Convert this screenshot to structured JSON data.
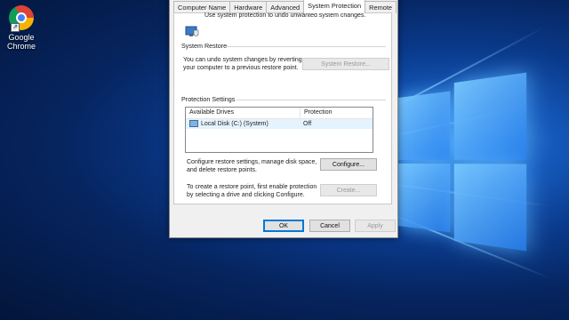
{
  "desktop": {
    "icons": [
      {
        "label_line1": "Google",
        "label_line2": "Chrome",
        "icon": "chrome-icon"
      }
    ]
  },
  "dialog": {
    "tabs": [
      "Computer Name",
      "Hardware",
      "Advanced",
      "System Protection",
      "Remote"
    ],
    "active_tab": "System Protection",
    "intro_text": "Use system protection to undo unwanted system changes.",
    "system_restore": {
      "heading": "System Restore",
      "text_line1": "You can undo system changes by reverting",
      "text_line2": "your computer to a previous restore point.",
      "button": "System Restore..."
    },
    "protection_settings": {
      "heading": "Protection Settings",
      "columns": [
        "Available Drives",
        "Protection"
      ],
      "rows": [
        {
          "drive": "Local Disk (C:) (System)",
          "protection": "Off"
        }
      ],
      "configure_text_line1": "Configure restore settings, manage disk space,",
      "configure_text_line2": "and delete restore points.",
      "configure_button": "Configure...",
      "create_text_line1": "To create a restore point, first enable protection",
      "create_text_line2": "by selecting a drive and clicking Configure.",
      "create_button": "Create..."
    },
    "footer": {
      "ok": "OK",
      "cancel": "Cancel",
      "apply": "Apply"
    }
  },
  "colors": {
    "desktop_blue": "#0a3a8c",
    "accent": "#0078d7"
  }
}
